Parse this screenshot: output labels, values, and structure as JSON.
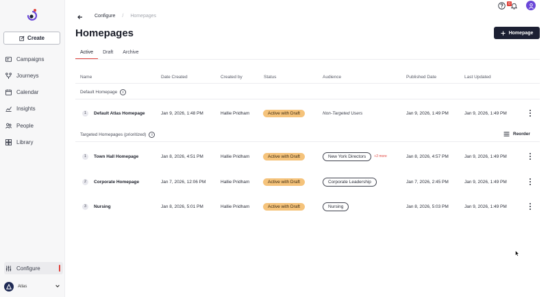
{
  "sidebar": {
    "create_label": "Create",
    "items": [
      {
        "label": "Campaigns"
      },
      {
        "label": "Journeys"
      },
      {
        "label": "Calendar"
      },
      {
        "label": "Insights"
      },
      {
        "label": "People"
      },
      {
        "label": "Library"
      }
    ],
    "configure_label": "Configure",
    "org_name": "Atlas"
  },
  "topbar": {
    "breadcrumb_parent": "Configure",
    "breadcrumb_sep": "/",
    "breadcrumb_current": "Homepages",
    "notification_count": "0"
  },
  "page": {
    "title": "Homepages",
    "new_button_label": "Homepage"
  },
  "tabs": [
    {
      "label": "Active"
    },
    {
      "label": "Draft"
    },
    {
      "label": "Archive"
    }
  ],
  "table": {
    "headers": {
      "name": "Name",
      "date_created": "Date Created",
      "created_by": "Created by",
      "status": "Status",
      "audience": "Audience",
      "published_date": "Published Date",
      "last_updated": "Last Updated"
    },
    "default_group_label": "Default Homepage",
    "targeted_group_label": "Targeted Homepages (prioritized)",
    "reorder_label": "Reorder",
    "default_row": {
      "priority": "1",
      "name": "Default Atlas Homepage",
      "date_created": "Jan 9, 2026, 1:48 PM",
      "created_by": "Hallie Pridham",
      "status": "Active with Draft",
      "audience": "Non-Targeted Users",
      "published_date": "Jan 9, 2026, 1:49 PM",
      "last_updated": "Jan 9, 2026, 1:49 PM"
    },
    "targeted_rows": [
      {
        "priority": "1",
        "name": "Town Hall Homepage",
        "date_created": "Jan 8, 2026, 4:51 PM",
        "created_by": "Hallie Pridham",
        "status": "Active with Draft",
        "audience": "New York Directors",
        "audience_more": "+2 more",
        "published_date": "Jan 8, 2026, 4:57 PM",
        "last_updated": "Jan 9, 2026, 1:49 PM"
      },
      {
        "priority": "2",
        "name": "Corporate Homepage",
        "date_created": "Jan 7, 2026, 12:06 PM",
        "created_by": "Hallie Pridham",
        "status": "Active with Draft",
        "audience": "Corporate Leadership",
        "audience_more": "",
        "published_date": "Jan 7, 2026, 2:45 PM",
        "last_updated": "Jan 9, 2026, 1:49 PM"
      },
      {
        "priority": "3",
        "name": "Nursing",
        "date_created": "Jan 8, 2026, 5:01 PM",
        "created_by": "Hallie Pridham",
        "status": "Active with Draft",
        "audience": "Nursing",
        "audience_more": "",
        "published_date": "Jan 8, 2026, 5:03 PM",
        "last_updated": "Jan 9, 2026, 1:49 PM"
      }
    ]
  },
  "colors": {
    "accent": "#e0413a",
    "primary_button": "#1c2033",
    "status_pill": "#f5c37b",
    "avatar": "#6a47d8"
  }
}
